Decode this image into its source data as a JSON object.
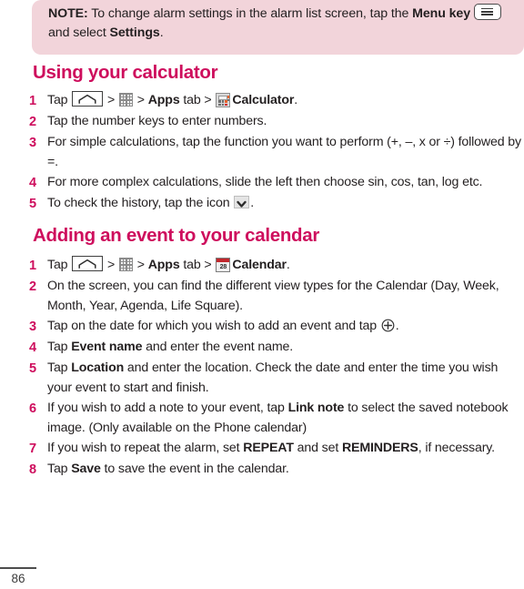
{
  "note": {
    "label": "NOTE:",
    "text_before_menu": " To change alarm settings in the alarm list screen, tap the ",
    "menu_key_label": "Menu key",
    "text_after_menu": " and select ",
    "settings_label": "Settings",
    "text_end": ".",
    "background_color": "#f2d4da"
  },
  "sections": [
    {
      "heading": "Using your calculator",
      "heading_color": "#ce0e5d",
      "steps": [
        {
          "number": "1",
          "parts": [
            {
              "t": "text",
              "v": "Tap "
            },
            {
              "t": "icon",
              "v": "home-key-icon"
            },
            {
              "t": "text",
              "v": " > "
            },
            {
              "t": "icon",
              "v": "apps-grid-icon"
            },
            {
              "t": "text",
              "v": " > "
            },
            {
              "t": "bold",
              "v": "Apps"
            },
            {
              "t": "text",
              "v": " tab > "
            },
            {
              "t": "icon",
              "v": "calculator-app-icon"
            },
            {
              "t": "bold",
              "v": "Calculator"
            },
            {
              "t": "text",
              "v": "."
            }
          ]
        },
        {
          "number": "2",
          "parts": [
            {
              "t": "text",
              "v": "Tap the number keys to enter numbers."
            }
          ]
        },
        {
          "number": "3",
          "parts": [
            {
              "t": "text",
              "v": "For simple calculations, tap the function you want to perform (+, –, x or ÷) followed by =."
            }
          ]
        },
        {
          "number": "4",
          "parts": [
            {
              "t": "text",
              "v": "For more complex calculations, slide the left then choose sin, cos, tan, log etc."
            }
          ]
        },
        {
          "number": "5",
          "parts": [
            {
              "t": "text",
              "v": "To check the history, tap the icon "
            },
            {
              "t": "icon",
              "v": "chevron-down-icon"
            },
            {
              "t": "text",
              "v": "."
            }
          ]
        }
      ]
    },
    {
      "heading": "Adding an event to your calendar",
      "heading_color": "#ce0e5d",
      "steps": [
        {
          "number": "1",
          "parts": [
            {
              "t": "text",
              "v": "Tap "
            },
            {
              "t": "icon",
              "v": "home-key-icon"
            },
            {
              "t": "text",
              "v": " > "
            },
            {
              "t": "icon",
              "v": "apps-grid-icon"
            },
            {
              "t": "text",
              "v": " > "
            },
            {
              "t": "bold",
              "v": "Apps"
            },
            {
              "t": "text",
              "v": " tab > "
            },
            {
              "t": "icon",
              "v": "calendar-app-icon"
            },
            {
              "t": "bold",
              "v": "Calendar"
            },
            {
              "t": "text",
              "v": "."
            }
          ]
        },
        {
          "number": "2",
          "parts": [
            {
              "t": "text",
              "v": "On the screen, you can find the different view types for the Calendar (Day, Week, Month, Year, Agenda, Life Square)."
            }
          ]
        },
        {
          "number": "3",
          "parts": [
            {
              "t": "text",
              "v": "Tap on the date for which you wish to add an event and tap "
            },
            {
              "t": "icon",
              "v": "plus-circle-icon"
            },
            {
              "t": "text",
              "v": "."
            }
          ]
        },
        {
          "number": "4",
          "parts": [
            {
              "t": "text",
              "v": "Tap "
            },
            {
              "t": "bold",
              "v": "Event name"
            },
            {
              "t": "text",
              "v": " and enter the event name."
            }
          ]
        },
        {
          "number": "5",
          "parts": [
            {
              "t": "text",
              "v": "Tap "
            },
            {
              "t": "bold",
              "v": "Location"
            },
            {
              "t": "text",
              "v": " and enter the location. Check the date and enter the time you wish your event to start and finish."
            }
          ]
        },
        {
          "number": "6",
          "parts": [
            {
              "t": "text",
              "v": "If you wish to add a note to your event, tap "
            },
            {
              "t": "bold",
              "v": "Link note"
            },
            {
              "t": "text",
              "v": " to select the saved notebook image. (Only available on the Phone calendar)"
            }
          ]
        },
        {
          "number": "7",
          "parts": [
            {
              "t": "text",
              "v": "If you wish to repeat the alarm, set "
            },
            {
              "t": "bold",
              "v": "REPEAT"
            },
            {
              "t": "text",
              "v": " and set "
            },
            {
              "t": "bold",
              "v": "REMINDERS"
            },
            {
              "t": "text",
              "v": ", if necessary."
            }
          ]
        },
        {
          "number": "8",
          "parts": [
            {
              "t": "text",
              "v": "Tap "
            },
            {
              "t": "bold",
              "v": "Save"
            },
            {
              "t": "text",
              "v": " to save the event in the calendar."
            }
          ]
        }
      ]
    }
  ],
  "calendar_icon_day": "28",
  "footer": {
    "page_number": "86"
  }
}
